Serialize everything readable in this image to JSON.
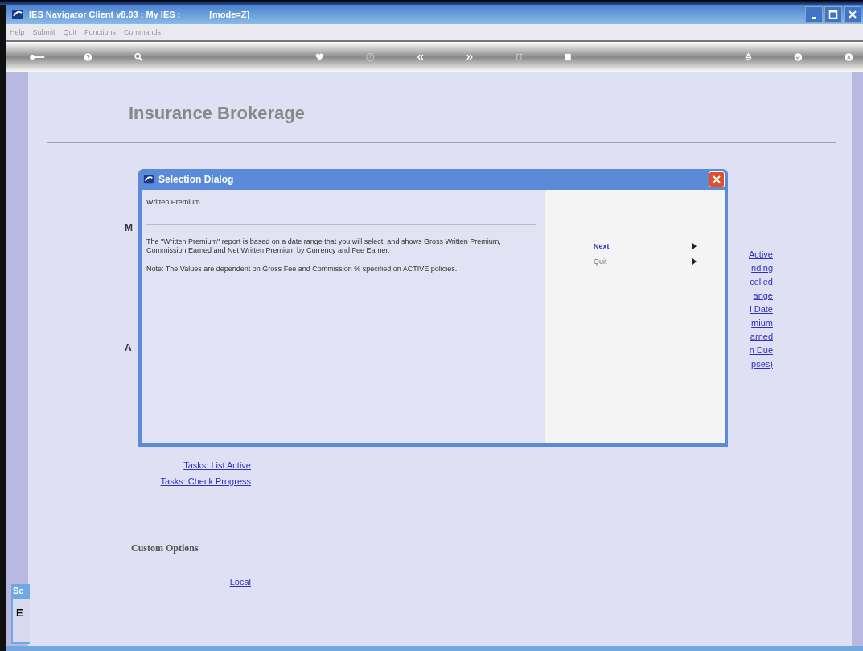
{
  "window": {
    "title": "IES Navigator Client v8.03 : My IES :",
    "mode": "[mode=Z]"
  },
  "menu": [
    "Help",
    "Submit",
    "Quit",
    "Functions",
    "Commands"
  ],
  "page": {
    "heading": "Insurance Brokerage",
    "left_labels": [
      "M",
      "A"
    ],
    "right_links": [
      "Active",
      "nding",
      "celled",
      "ange",
      "l Date",
      "mium",
      "arned",
      "n Due",
      "pses)"
    ],
    "task_links": [
      "Tasks: List Active",
      "Tasks: Check Progress"
    ],
    "custom_heading": "Custom Options",
    "custom_links": [
      "Local"
    ]
  },
  "side_window": {
    "title": "Se",
    "text": "E"
  },
  "dialog": {
    "title": "Selection Dialog",
    "subtitle": "Written Premium",
    "paragraphs": [
      "The \"Written Premium\" report is based on a date range that you will select, and shows Gross Written Premium, Commission Earned and Net Written Premium by Currency and Fee Earner.",
      "Note: The Values are dependent on Gross Fee and Commission % specified on ACTIVE policies."
    ],
    "actions": [
      {
        "label": "Next",
        "selected": true
      },
      {
        "label": "Quit",
        "selected": false
      }
    ]
  }
}
